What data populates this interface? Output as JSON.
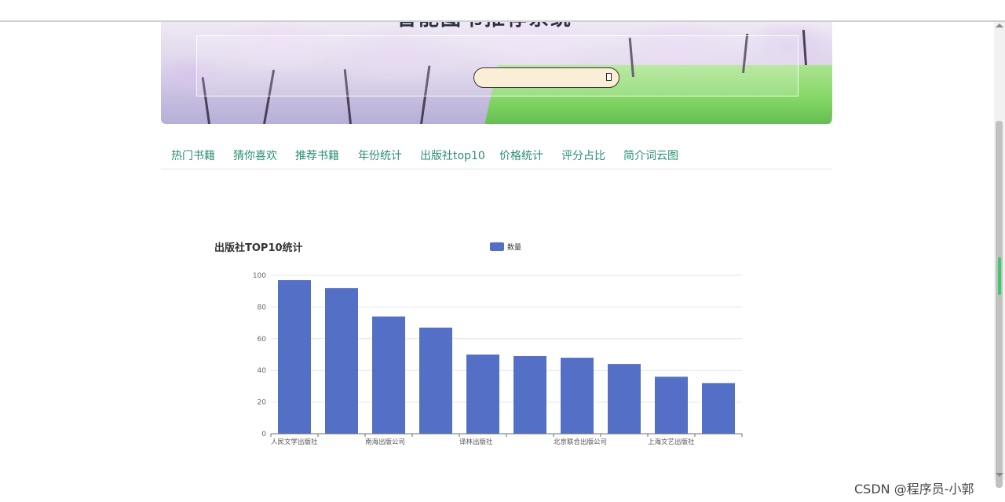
{
  "header": {
    "site_title": "智能图书推荐系统",
    "search": {
      "value": "",
      "placeholder": ""
    }
  },
  "nav": {
    "items": [
      "热门书籍",
      "猜你喜欢",
      "推荐书籍",
      "年份统计",
      "出版社top10",
      "价格统计",
      "评分占比",
      "简介词云图"
    ]
  },
  "chart_data": {
    "type": "bar",
    "title": "出版社TOP10统计",
    "legend": {
      "position": "top-center",
      "entries": [
        "数量"
      ]
    },
    "series": [
      {
        "name": "数量",
        "color": "#5470c6",
        "values": [
          97,
          92,
          74,
          67,
          50,
          49,
          48,
          44,
          36,
          32
        ]
      }
    ],
    "categories": [
      "人民文学出版社",
      "",
      "南海出版公司",
      "",
      "译林出版社",
      "",
      "北京联合出版公司",
      "",
      "上海文艺出版社",
      ""
    ],
    "yticks": [
      0,
      20,
      40,
      60,
      80,
      100
    ],
    "ylim": [
      0,
      100
    ],
    "grid": "horizontal",
    "xlabel": "",
    "ylabel": ""
  },
  "footer": {
    "watermark": "CSDN @程序员-小郭"
  }
}
